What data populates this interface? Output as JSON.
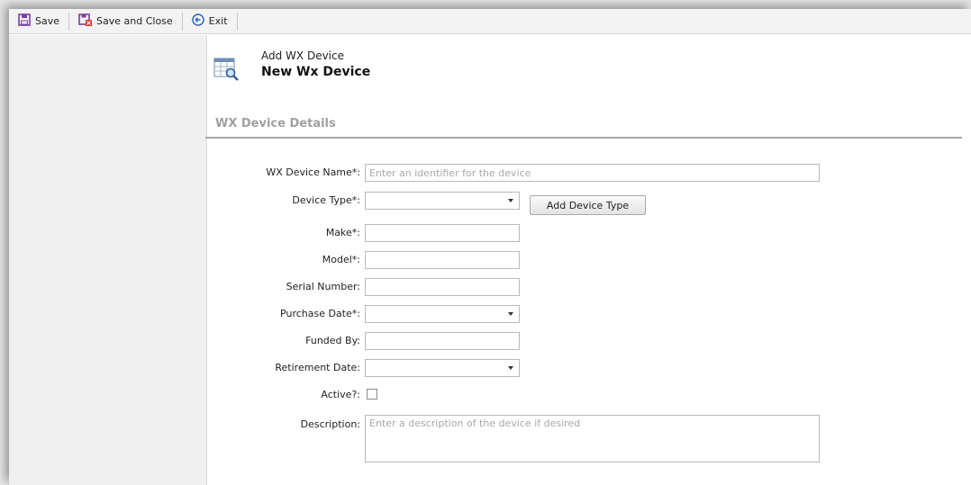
{
  "toolbar": {
    "save_label": "Save",
    "save_close_label": "Save and Close",
    "exit_label": "Exit"
  },
  "header": {
    "subtitle": "Add WX Device",
    "title": "New Wx Device"
  },
  "section": {
    "title": "WX Device Details"
  },
  "form": {
    "name_label": "WX Device Name*:",
    "name_placeholder": "Enter an identifier for the device",
    "device_type_label": "Device Type*:",
    "add_device_type_label": "Add Device Type",
    "make_label": "Make*:",
    "model_label": "Model*:",
    "serial_label": "Serial Number:",
    "purchase_date_label": "Purchase Date*:",
    "funded_by_label": "Funded By:",
    "retirement_date_label": "Retirement Date:",
    "active_label": "Active?:",
    "description_label": "Description:",
    "description_placeholder": "Enter a description of the device if desired"
  },
  "colors": {
    "save_icon": "#7b3fa0",
    "section_title": "#a0a0a0",
    "exit_icon": "#2a62b5"
  }
}
